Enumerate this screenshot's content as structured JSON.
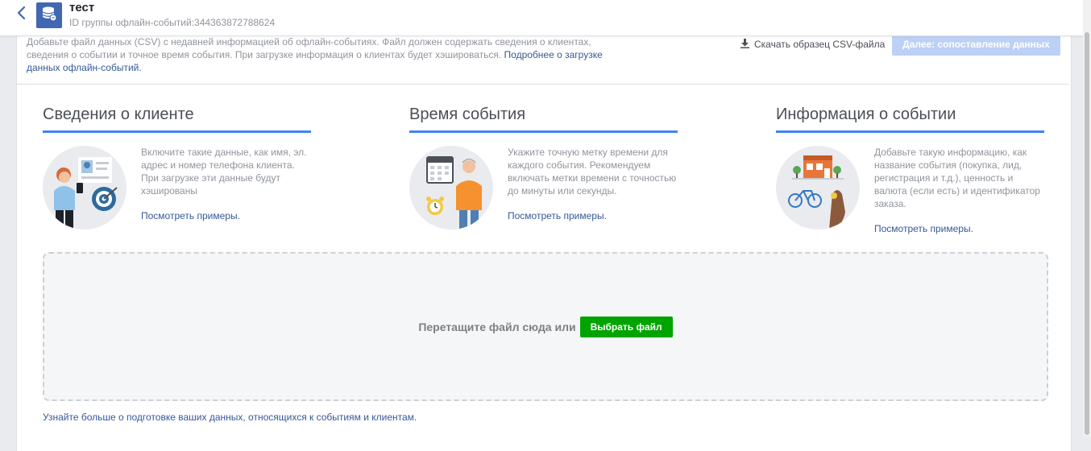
{
  "header": {
    "title": "тест",
    "subtitle": "ID группы офлайн-событий:344363872788624"
  },
  "intro": {
    "text": "Добавьте файл данных (CSV) с недавней информацией об офлайн-событиях. Файл должен содержать сведения о клиентах, сведения о событии и точное время события. При загрузке информация о клиентах будет хэшироваться. ",
    "link": "Подробнее о загрузке данных офлайн-событий."
  },
  "toolbar": {
    "download_label": "Скачать образец CSV-файла",
    "next_label": "Далее: сопоставление данных"
  },
  "columns": [
    {
      "title": "Сведения о клиенте",
      "text": "Включите такие данные, как имя, эл. адрес и номер телефона клиента. При загрузке эти данные будут хэшированы",
      "link": "Посмотреть примеры."
    },
    {
      "title": "Время события",
      "text": "Укажите точную метку времени для каждого события. Рекомендуем включать метки времени с точностью до минуты или секунды.",
      "link": "Посмотреть примеры."
    },
    {
      "title": "Информация о событии",
      "text": "Добавьте такую информацию, как название события (покупка, лид, регистрация и т.д.), ценность и валюта (если есть) и идентификатор заказа.",
      "link": "Посмотреть примеры."
    }
  ],
  "dropzone": {
    "text": "Перетащите файл сюда или",
    "button_label": "Выбрать файл"
  },
  "footer": {
    "link": "Узнайте больше о подготовке ваших данных, относящихся к событиям и клиентам."
  },
  "colors": {
    "accent": "#4080ff",
    "link": "#365899",
    "button_green": "#00a400",
    "button_disabled": "#bdd0f6",
    "header_icon": "#4267b2"
  },
  "icons": {
    "back": "chevron-left-icon",
    "app": "database-icon",
    "download": "download-icon"
  }
}
